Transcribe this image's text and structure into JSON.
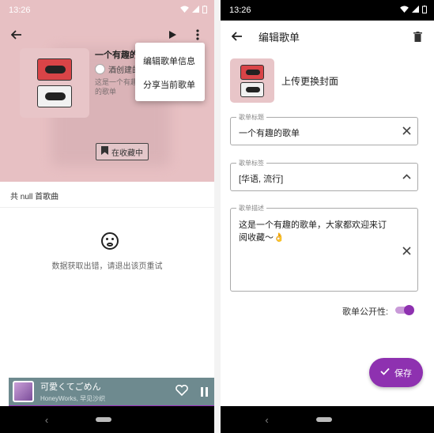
{
  "left": {
    "status_time": "13:26",
    "playlist_title": "一个有趣的",
    "creator": "酒创建的",
    "desc": "这是一个有趣的歌单",
    "collect_label": "在收藏中",
    "menu": {
      "edit": "编辑歌单信息",
      "share": "分享当前歌单"
    },
    "song_count": "共 null 首歌曲",
    "error_text": "数据获取出错，请退出该页重试",
    "player": {
      "title": "可愛くてごめん",
      "artist": "HoneyWorks, 早见沙织"
    }
  },
  "right": {
    "status_time": "13:26",
    "title": "编辑歌单",
    "upload_label": "上传更换封面",
    "name_field": {
      "label": "歌单标题",
      "value": "一个有趣的歌单"
    },
    "tags_field": {
      "label": "歌单标签",
      "value": "[华语, 流行]"
    },
    "desc_field": {
      "label": "歌单描述",
      "line1": "这是一个有趣的歌单，大家都欢迎来订",
      "line2": "阅收藏～👌"
    },
    "public_label": "歌单公开性:",
    "public_enabled": true,
    "save_label": "保存"
  },
  "colors": {
    "accent": "#8e31b0",
    "hero_bg": "#e7c0c3",
    "player_bg": "#6e8a8f"
  },
  "icons": [
    "back-arrow-icon",
    "play-icon",
    "more-vert-icon",
    "bookmark-icon",
    "sad-face-icon",
    "heart-icon",
    "pause-icon",
    "delete-icon",
    "clear-icon",
    "chevron-up-icon",
    "check-icon",
    "wifi-icon",
    "signal-icon",
    "battery-icon"
  ]
}
